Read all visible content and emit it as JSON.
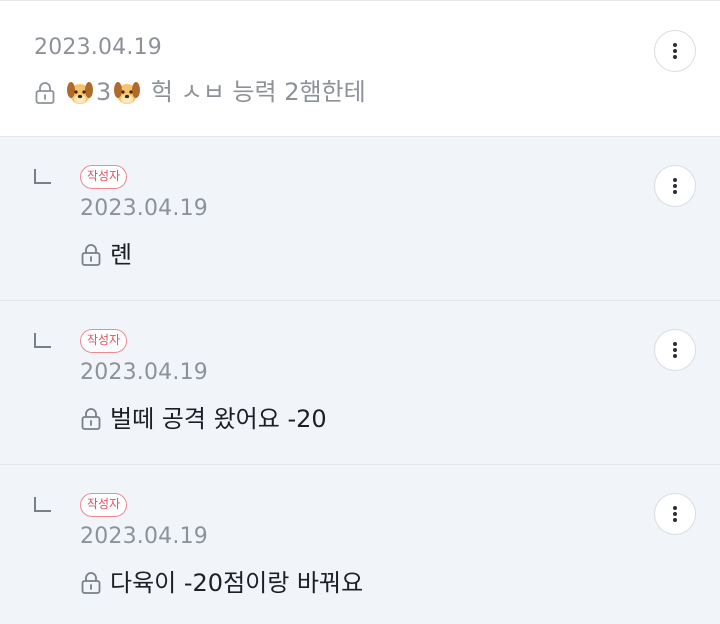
{
  "comments": [
    {
      "date": "2023.04.19",
      "text_parts": [
        "",
        "3",
        " 헉 ㅅㅂ 능력 2햄한테"
      ],
      "dog_icon": "dog-face-emoji"
    }
  ],
  "replies": [
    {
      "badge": "작성자",
      "date": "2023.04.19",
      "text": "롄"
    },
    {
      "badge": "작성자",
      "date": "2023.04.19",
      "text": "벌떼 공격 왔어요 -20"
    },
    {
      "badge": "작성자",
      "date": "2023.04.19",
      "text": "다육이 -20점이랑 바꿔요"
    }
  ],
  "colors": {
    "reply_bg": "#f1f5fa",
    "badge_red": "#e2505b",
    "date_gray": "#8d9299"
  }
}
